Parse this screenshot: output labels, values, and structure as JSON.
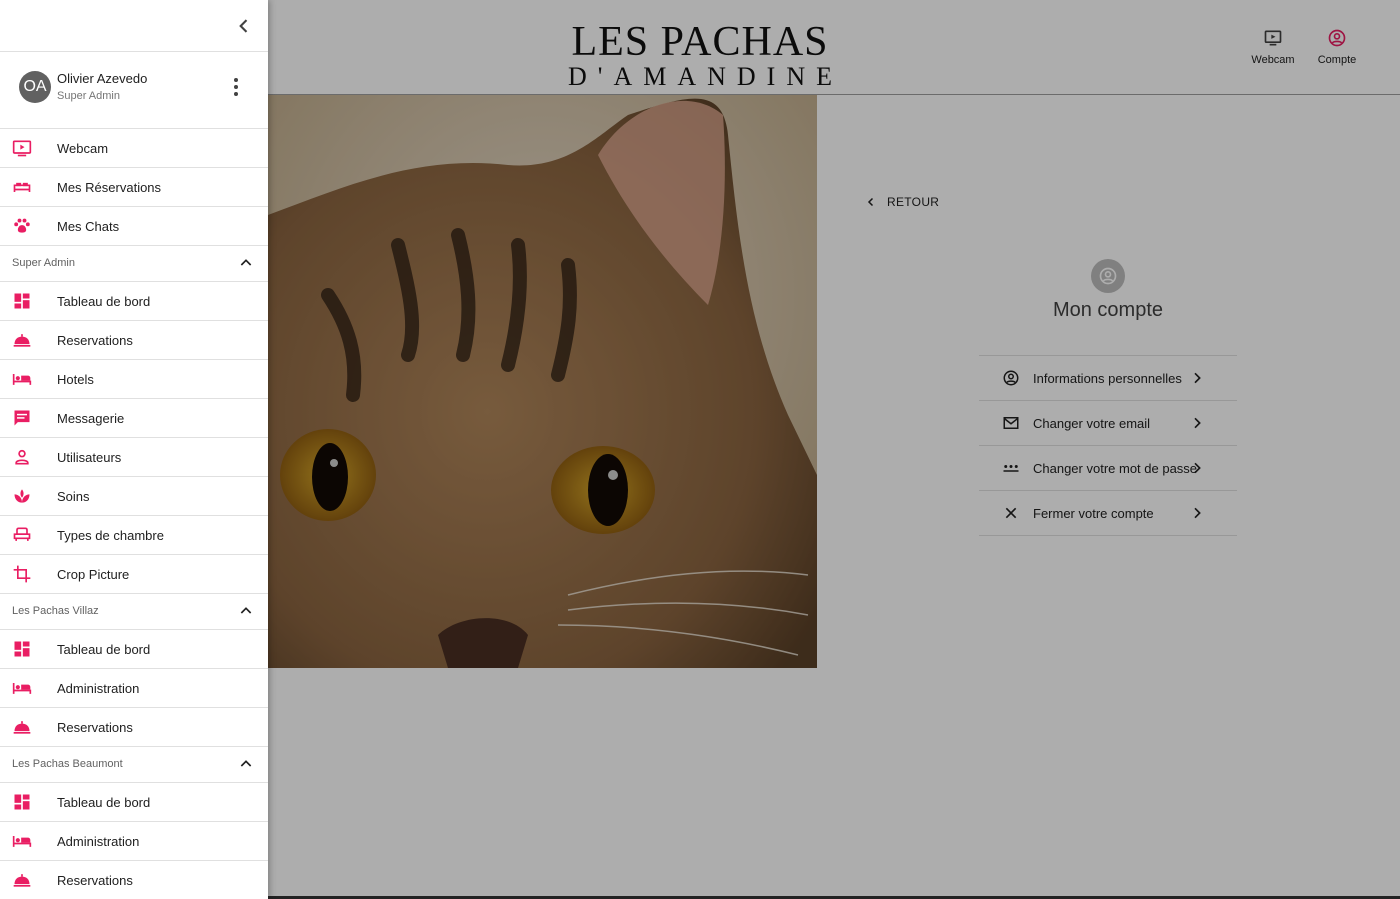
{
  "colors": {
    "accent": "#e91e63",
    "scrim": "rgba(0,0,0,0.32)"
  },
  "logo": {
    "line1": "LES PACHAS",
    "line2": "D'AMANDINE"
  },
  "header": {
    "actions": [
      {
        "label": "Webcam",
        "icon": "tv-play-icon"
      },
      {
        "label": "Compte",
        "icon": "account-circle-icon"
      }
    ]
  },
  "account": {
    "back_label": "RETOUR",
    "title": "Mon compte",
    "items": [
      {
        "label": "Informations personnelles",
        "icon": "account-circle-icon"
      },
      {
        "label": "Changer votre email",
        "icon": "mail-icon"
      },
      {
        "label": "Changer votre mot de passe",
        "icon": "password-dots-icon"
      },
      {
        "label": "Fermer votre compte",
        "icon": "close-icon"
      }
    ]
  },
  "drawer": {
    "user": {
      "initials": "OA",
      "name": "Olivier Azevedo",
      "role": "Super Admin"
    },
    "items": [
      {
        "label": "Webcam",
        "icon": "tv-play-icon"
      },
      {
        "label": "Mes Réservations",
        "icon": "bed-icon"
      },
      {
        "label": "Mes Chats",
        "icon": "paw-icon"
      }
    ],
    "sections": [
      {
        "title": "Super Admin",
        "items": [
          {
            "label": "Tableau de bord",
            "icon": "dashboard-icon"
          },
          {
            "label": "Reservations",
            "icon": "room-service-icon"
          },
          {
            "label": "Hotels",
            "icon": "hotel-bed-icon"
          },
          {
            "label": "Messagerie",
            "icon": "message-icon"
          },
          {
            "label": "Utilisateurs",
            "icon": "person-icon"
          },
          {
            "label": "Soins",
            "icon": "spa-icon"
          },
          {
            "label": "Types de chambre",
            "icon": "seat-icon"
          },
          {
            "label": "Crop Picture",
            "icon": "crop-icon"
          }
        ]
      },
      {
        "title": "Les Pachas Villaz",
        "items": [
          {
            "label": "Tableau de bord",
            "icon": "dashboard-icon"
          },
          {
            "label": "Administration",
            "icon": "hotel-bed-icon"
          },
          {
            "label": "Reservations",
            "icon": "room-service-icon"
          }
        ]
      },
      {
        "title": "Les Pachas Beaumont",
        "items": [
          {
            "label": "Tableau de bord",
            "icon": "dashboard-icon"
          },
          {
            "label": "Administration",
            "icon": "hotel-bed-icon"
          },
          {
            "label": "Reservations",
            "icon": "room-service-icon"
          }
        ]
      }
    ]
  }
}
